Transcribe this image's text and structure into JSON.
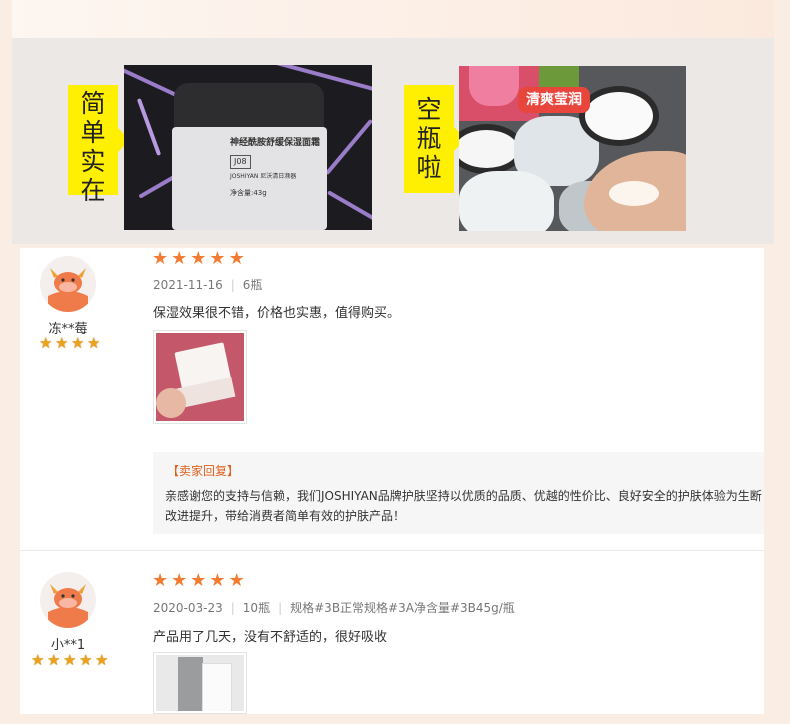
{
  "banner": {
    "caption_left": [
      "简",
      "单",
      "实",
      "在"
    ],
    "caption_right": [
      "空",
      "瓶",
      "啦"
    ],
    "jar_label_title": "神经酰胺舒缓保湿面霜",
    "jar_label_code": "J08",
    "jar_label_brand": "JOSHIYAN 尼沃清日濒器",
    "jar_label_weight": "净含量:43g",
    "tag_right": "清爽莹润"
  },
  "reviews": [
    {
      "nickname": "冻**莓",
      "level_stars": 4,
      "rating": 5,
      "date": "2021-11-16",
      "quantity": "6瓶",
      "spec": "",
      "text": "保湿效果很不错，价格也实惠，值得购买。",
      "has_photo": true,
      "reply_title": "【卖家回复】",
      "reply_text": "亲感谢您的支持与信赖，我们JOSHIYAN品牌护肤坚持以优质的品质、优越的性价比、良好安全的护肤体验为生断改进提升，带给消费者简单有效的护肤产品！"
    },
    {
      "nickname": "小**1",
      "level_stars": 5,
      "rating": 5,
      "date": "2020-03-23",
      "quantity": "10瓶",
      "spec": "规格#3B正常规格#3A净含量#3B45g/瓶",
      "text": "产品用了几天，没有不舒适的，很好吸收",
      "has_photo": true
    }
  ],
  "colors": {
    "accent_star": "#f27c33",
    "caption_yellow": "#ffef00",
    "reply_title": "#e4601d"
  }
}
